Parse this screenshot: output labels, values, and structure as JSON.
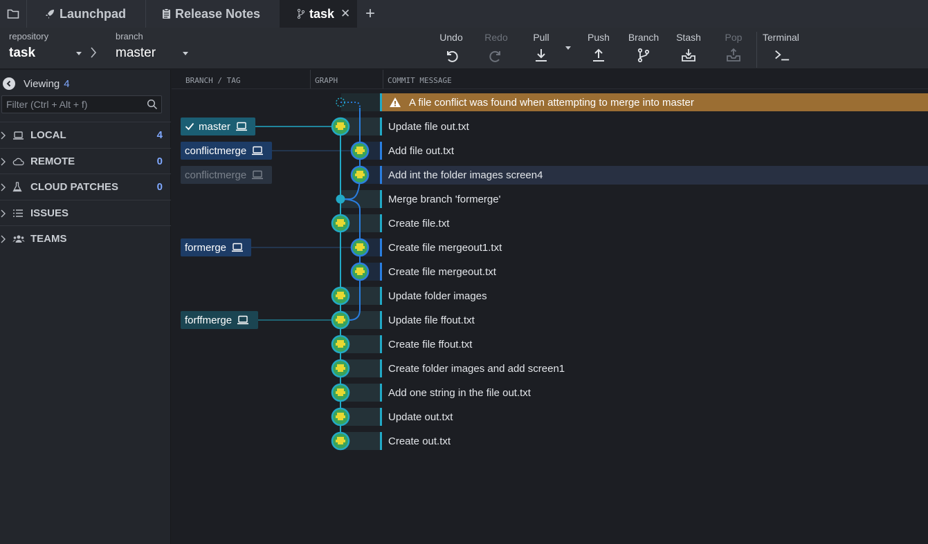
{
  "tabs": {
    "launchpad": "Launchpad",
    "release_notes": "Release Notes",
    "task": "task"
  },
  "toolbar": {
    "repository_label": "repository",
    "repository_value": "task",
    "branch_label": "branch",
    "branch_value": "master",
    "undo": "Undo",
    "redo": "Redo",
    "pull": "Pull",
    "push": "Push",
    "branch": "Branch",
    "stash": "Stash",
    "pop": "Pop",
    "terminal": "Terminal"
  },
  "sidebar": {
    "viewing_label": "Viewing",
    "viewing_count": "4",
    "filter_placeholder": "Filter (Ctrl + Alt + f)",
    "sections": [
      {
        "label": "LOCAL",
        "count": "4"
      },
      {
        "label": "REMOTE",
        "count": "0"
      },
      {
        "label": "CLOUD PATCHES",
        "count": "0"
      },
      {
        "label": "ISSUES",
        "count": ""
      },
      {
        "label": "TEAMS",
        "count": ""
      }
    ]
  },
  "columns": {
    "branch_tag": "BRANCH / TAG",
    "graph": "GRAPH",
    "commit_message": "COMMIT MESSAGE"
  },
  "conflict_banner": "A file conflict was found when attempting to merge into master",
  "branches": {
    "master": "master",
    "conflictmerge": "conflictmerge",
    "conflictmerge_remote": "conflictmerge",
    "formerge": "formerge",
    "forffmerge": "forffmerge"
  },
  "commits": [
    "Update file out.txt",
    "Add file out.txt",
    "Add int the folder images screen4",
    "Merge branch 'formerge'",
    "Create file.txt",
    "Create file mergeout1.txt",
    "Create file mergeout.txt",
    "Update folder images",
    "Update file ffout.txt",
    "Create file ffout.txt",
    "Create folder images and add screen1",
    "Add one string in the file out.txt",
    "Update out.txt",
    "Create out.txt"
  ],
  "colors": {
    "accent_teal": "#22a9c6",
    "accent_blue": "#2a7ee0",
    "conflict_banner": "#9b6e33",
    "count_blue": "#7fa8ff"
  }
}
